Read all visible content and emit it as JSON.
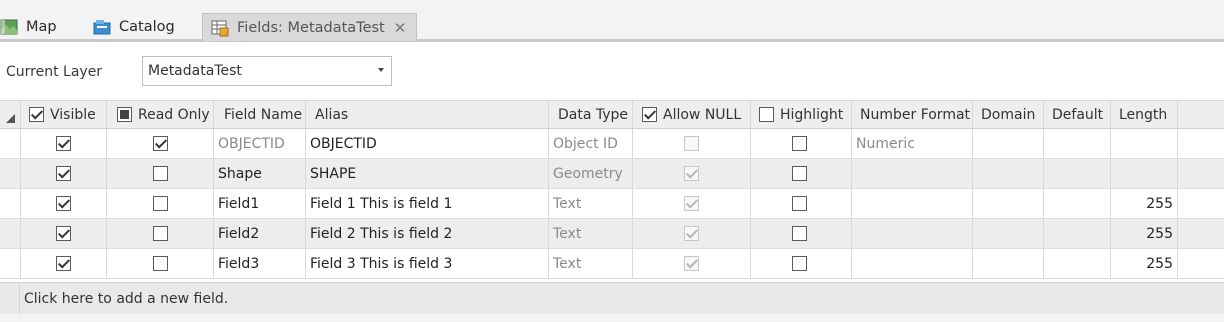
{
  "tabs": [
    {
      "label": "Map",
      "icon": "map-icon"
    },
    {
      "label": "Catalog",
      "icon": "catalog-icon"
    },
    {
      "label": "Fields:  MetadataTest",
      "icon": "fields-table-icon",
      "active": true
    }
  ],
  "current_layer": {
    "label": "Current Layer",
    "value": "MetadataTest"
  },
  "columns": [
    "Visible",
    "Read Only",
    "Field Name",
    "Alias",
    "Data Type",
    "Allow NULL",
    "Highlight",
    "Number Format",
    "Domain",
    "Default",
    "Length"
  ],
  "rows": [
    {
      "visible": true,
      "read_only": true,
      "field_name": "OBJECTID",
      "alias": "OBJECTID",
      "data_type": "Object ID",
      "allow_null": false,
      "highlight": false,
      "number_format": "Numeric",
      "domain": "",
      "default": "",
      "length": ""
    },
    {
      "visible": true,
      "read_only": false,
      "field_name": "Shape",
      "alias": "SHAPE",
      "data_type": "Geometry",
      "allow_null": true,
      "highlight": false,
      "number_format": "",
      "domain": "",
      "default": "",
      "length": ""
    },
    {
      "visible": true,
      "read_only": false,
      "field_name": "Field1",
      "alias": "Field 1  This is field 1",
      "data_type": "Text",
      "allow_null": true,
      "highlight": false,
      "number_format": "",
      "domain": "",
      "default": "",
      "length": "255"
    },
    {
      "visible": true,
      "read_only": false,
      "field_name": "Field2",
      "alias": "Field 2 This is field 2",
      "data_type": "Text",
      "allow_null": true,
      "highlight": false,
      "number_format": "",
      "domain": "",
      "default": "",
      "length": "255"
    },
    {
      "visible": true,
      "read_only": false,
      "field_name": "Field3",
      "alias": "Field 3 This is field 3",
      "data_type": "Text",
      "allow_null": true,
      "highlight": false,
      "number_format": "",
      "domain": "",
      "default": "",
      "length": "255"
    }
  ],
  "add_field_text": "Click here to add a new field."
}
